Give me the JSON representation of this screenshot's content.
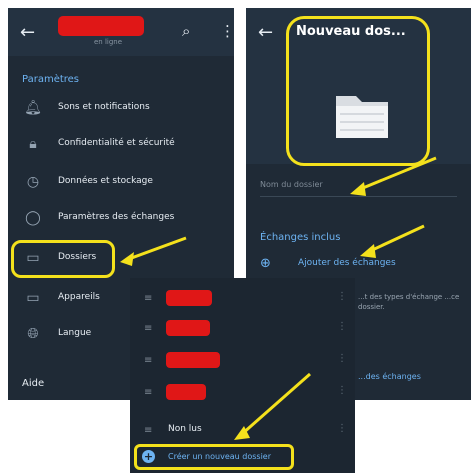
{
  "left_panel": {
    "subtitle": "en ligne",
    "section": "Paramètres",
    "items": [
      {
        "label": "Sons et notifications",
        "icon": "bell-icon"
      },
      {
        "label": "Confidentialité et sécurité",
        "icon": "lock-icon"
      },
      {
        "label": "Données et stockage",
        "icon": "clock-icon"
      },
      {
        "label": "Paramètres des échanges",
        "icon": "chat-bubble-icon"
      },
      {
        "label": "Dossiers",
        "icon": "folder-icon"
      },
      {
        "label": "Appareils",
        "icon": "devices-icon"
      },
      {
        "label": "Langue",
        "icon": "globe-icon"
      }
    ],
    "help_section": "Aide"
  },
  "right_panel": {
    "title": "Nouveau dos...",
    "field_label": "Nom du dossier",
    "section": "Échanges inclus",
    "add_label": "Ajouter des échanges",
    "hint": "...t des types d'échange ...ce dossier.",
    "footer_link": "...des échanges"
  },
  "bottom_panel": {
    "items_redacted": 4,
    "unread_label": "Non lus",
    "create_label": "Créer un nouveau dossier"
  },
  "colors": {
    "accent": "#6db3f2",
    "highlight": "#f4e11c",
    "redaction": "#e01717"
  }
}
